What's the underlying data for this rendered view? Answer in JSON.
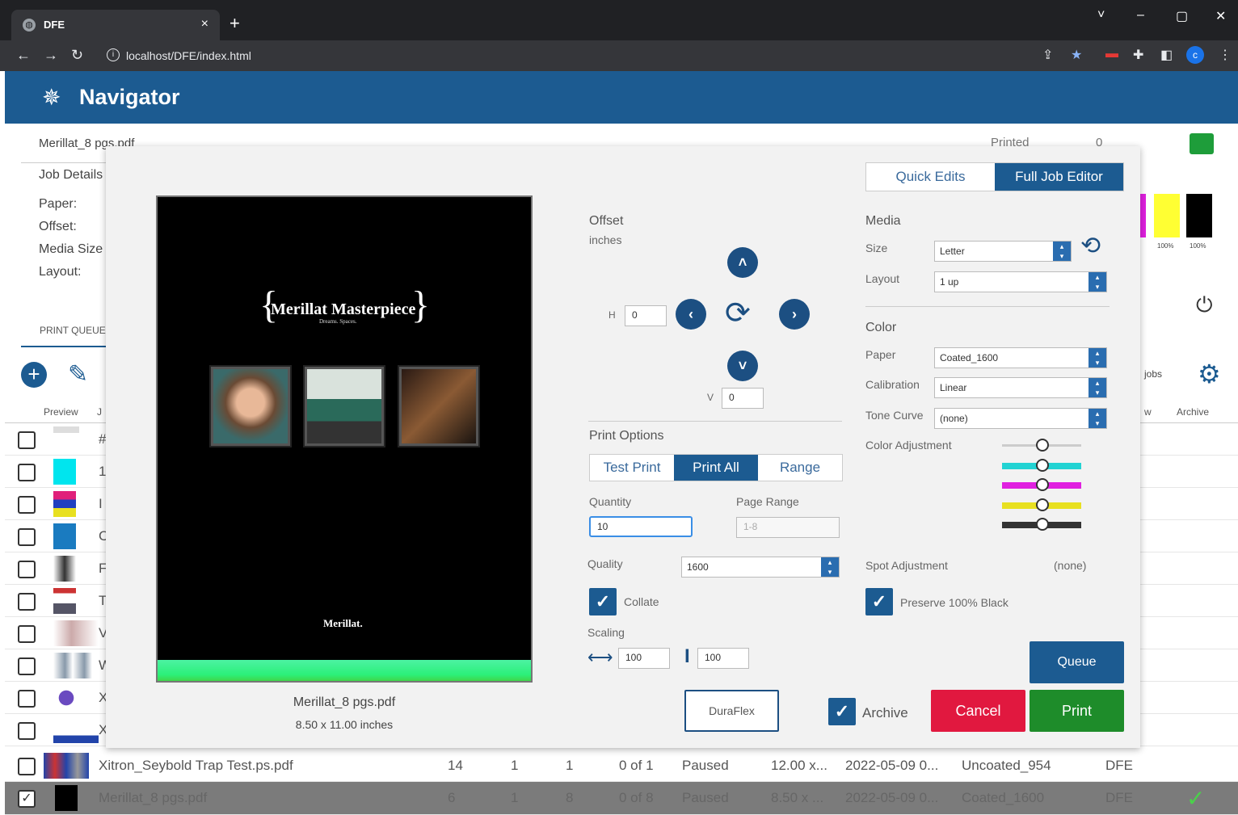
{
  "browser": {
    "tab_title": "DFE",
    "tab_close": "×",
    "new_tab": "+",
    "url": "localhost/DFE/index.html",
    "window_controls": [
      "˅",
      "–",
      "▢",
      "✕"
    ]
  },
  "app": {
    "title": "Navigator"
  },
  "background": {
    "job_name": "Merillat_8 pgs.pdf",
    "printed_label": "Printed",
    "printed_value": "0",
    "job_details_label": "Job Details",
    "details_labels": [
      "Paper:",
      "Offset:",
      "Media Size",
      "Layout:"
    ],
    "print_queue_label": "PRINT QUEUE",
    "ink_labels": [
      "100%",
      "100%"
    ],
    "jobs_label": "jobs",
    "columns": {
      "preview": "Preview",
      "job": "J",
      "overview": "w",
      "archive": "Archive"
    },
    "row_letters": [
      "#",
      "1",
      "I",
      "C",
      "F",
      "T",
      "V",
      "W",
      "X",
      "X"
    ],
    "rows": [
      {
        "name": "Xitron_Seybold Trap Test.ps.pdf",
        "pages": "14",
        "copies": "1",
        "sets": "1",
        "progress": "0 of 1",
        "status": "Paused",
        "size": "12.00 x...",
        "date": "2022-05-09 0...",
        "paper": "Uncoated_954",
        "printer": "DFE",
        "checked": false
      },
      {
        "name": "Merillat_8 pgs.pdf",
        "pages": "6",
        "copies": "1",
        "sets": "8",
        "progress": "0 of 8",
        "status": "Paused",
        "size": "8.50 x ...",
        "date": "2022-05-09 0...",
        "paper": "Coated_1600",
        "printer": "DFE",
        "checked": true
      }
    ]
  },
  "modal": {
    "preview": {
      "brand": "Merillat Masterpiece",
      "brand_sub": "Dreams. Spaces.",
      "logo": "Merillat.",
      "file_name": "Merillat_8 pgs.pdf",
      "file_size": "8.50 x 11.00 inches"
    },
    "offset": {
      "title": "Offset",
      "unit": "inches",
      "h_label": "H",
      "h_value": "0",
      "v_label": "V",
      "v_value": "0"
    },
    "print_options": {
      "title": "Print Options",
      "modes": [
        "Test Print",
        "Print All",
        "Range"
      ],
      "active_mode": "Print All",
      "quantity_label": "Quantity",
      "quantity_value": "10",
      "page_range_label": "Page Range",
      "page_range_placeholder": "1-8",
      "quality_label": "Quality",
      "quality_value": "1600",
      "collate_label": "Collate",
      "scaling_label": "Scaling",
      "scale_x": "100",
      "scale_y": "100"
    },
    "editor_tabs": [
      "Quick Edits",
      "Full Job Editor"
    ],
    "active_editor_tab": "Full Job Editor",
    "media": {
      "title": "Media",
      "size_label": "Size",
      "size_value": "Letter",
      "layout_label": "Layout",
      "layout_value": "1 up"
    },
    "color": {
      "title": "Color",
      "paper_label": "Paper",
      "paper_value": "Coated_1600",
      "calibration_label": "Calibration",
      "calibration_value": "Linear",
      "tone_curve_label": "Tone Curve",
      "tone_curve_value": "(none)",
      "color_adjustment_label": "Color Adjustment",
      "slider_colors": [
        "#cccccc",
        "#22d3d3",
        "#e020e0",
        "#e8e020",
        "#333333"
      ],
      "spot_adjustment_label": "Spot Adjustment",
      "spot_adjustment_value": "(none)",
      "preserve_black_label": "Preserve 100% Black"
    },
    "buttons": {
      "duraflex": "DuraFlex",
      "archive": "Archive",
      "cancel": "Cancel",
      "print": "Print",
      "queue": "Queue"
    }
  }
}
